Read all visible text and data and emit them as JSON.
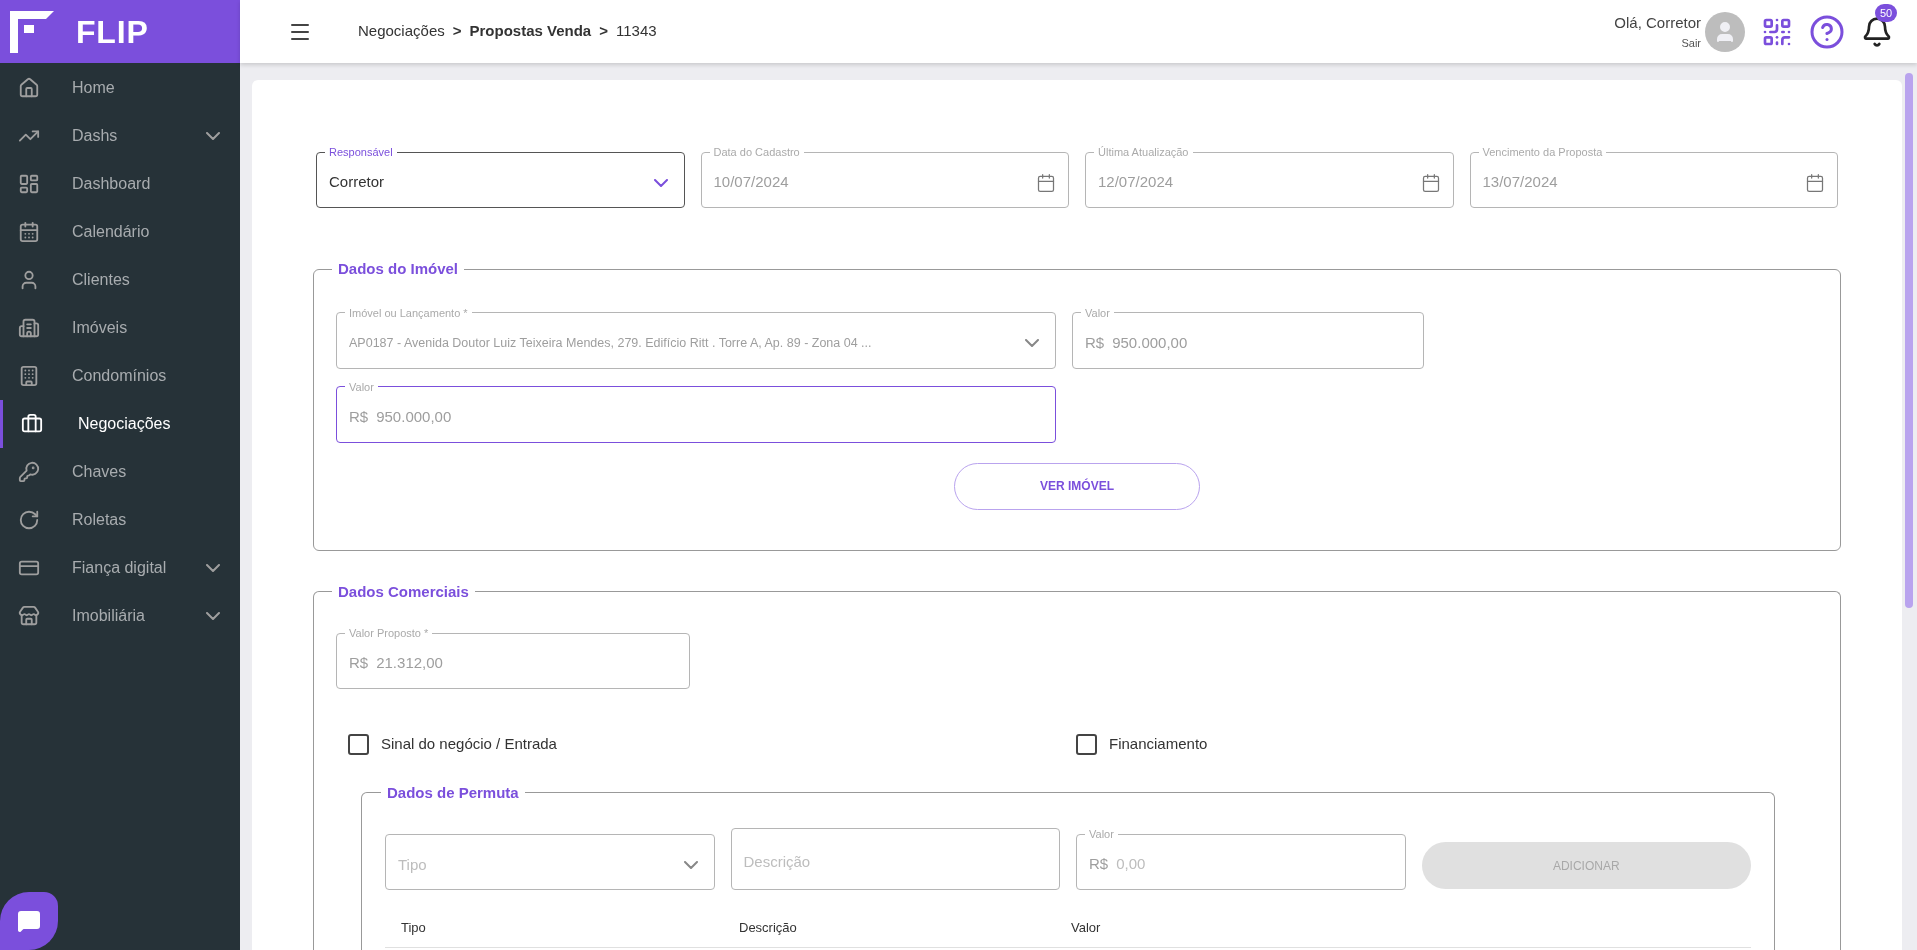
{
  "sidebar": {
    "logo": "FLIP",
    "items": [
      {
        "label": "Home",
        "expandable": false,
        "selected": false
      },
      {
        "label": "Dashs",
        "expandable": true,
        "selected": false
      },
      {
        "label": "Dashboard",
        "expandable": false,
        "selected": false
      },
      {
        "label": "Calendário",
        "expandable": false,
        "selected": false
      },
      {
        "label": "Clientes",
        "expandable": false,
        "selected": false
      },
      {
        "label": "Imóveis",
        "expandable": false,
        "selected": false
      },
      {
        "label": "Condomínios",
        "expandable": false,
        "selected": false
      },
      {
        "label": "Negociações",
        "expandable": false,
        "selected": true
      },
      {
        "label": "Chaves",
        "expandable": false,
        "selected": false
      },
      {
        "label": "Roletas",
        "expandable": false,
        "selected": false
      },
      {
        "label": "Fiança digital",
        "expandable": true,
        "selected": false
      },
      {
        "label": "Imobiliária",
        "expandable": true,
        "selected": false
      }
    ]
  },
  "topbar": {
    "breadcrumb": [
      {
        "label": "Negociações",
        "bold": false
      },
      {
        "label": "Propostas Venda",
        "bold": true
      },
      {
        "label": "11343",
        "bold": false
      }
    ],
    "separator": ">",
    "greeting": "Olá, Corretor",
    "logout": "Sair",
    "notifications": "50"
  },
  "header_fields": [
    {
      "kind": "select",
      "label": "Responsável",
      "value": "Corretor",
      "focused": true,
      "disabled": false
    },
    {
      "kind": "date",
      "label": "Data do Cadastro",
      "value": "10/07/2024",
      "focused": false,
      "disabled": true
    },
    {
      "kind": "date",
      "label": "Última Atualização",
      "value": "12/07/2024",
      "focused": false,
      "disabled": true
    },
    {
      "kind": "date",
      "label": "Vencimento da Proposta",
      "value": "13/07/2024",
      "focused": false,
      "disabled": true
    }
  ],
  "property_section": {
    "title": "Dados do Imóvel",
    "fields": [
      {
        "kind": "select",
        "label": "Imóvel ou Lançamento *",
        "value": "AP0187 - Avenida Doutor Luiz Teixeira Mendes, 279. Edifício Ritt . Torre A, Ap. 89 - Zona 04 ...",
        "focused": false,
        "disabled": true
      },
      {
        "kind": "money",
        "label": "Valor",
        "prefix": "R$",
        "value": "950.000,00",
        "focused": false,
        "disabled": true
      },
      {
        "kind": "money",
        "label": "Valor",
        "prefix": "R$",
        "value": "950.000,00",
        "focused": true,
        "disabled": true
      }
    ],
    "button": "VER IMÓVEL"
  },
  "commercial_section": {
    "title": "Dados Comerciais",
    "proposed_value": {
      "kind": "money",
      "label": "Valor Proposto *",
      "prefix": "R$",
      "value": "21.312,00",
      "focused": false,
      "disabled": true
    },
    "checkboxes": [
      {
        "label": "Sinal do negócio / Entrada",
        "checked": false
      },
      {
        "label": "Financiamento",
        "checked": false
      }
    ],
    "exchange": {
      "title": "Dados de Permuta",
      "fields": [
        {
          "kind": "select",
          "placeholder": "Tipo",
          "focused": false
        },
        {
          "kind": "text",
          "placeholder": "Descrição",
          "focused": false
        },
        {
          "kind": "money",
          "label": "Valor",
          "prefix": "R$",
          "placeholder": "0,00",
          "focused": false
        }
      ],
      "add_button": {
        "label": "ADICIONAR",
        "disabled": true
      },
      "columns": [
        "Tipo",
        "Descrição",
        "Valor"
      ]
    }
  }
}
